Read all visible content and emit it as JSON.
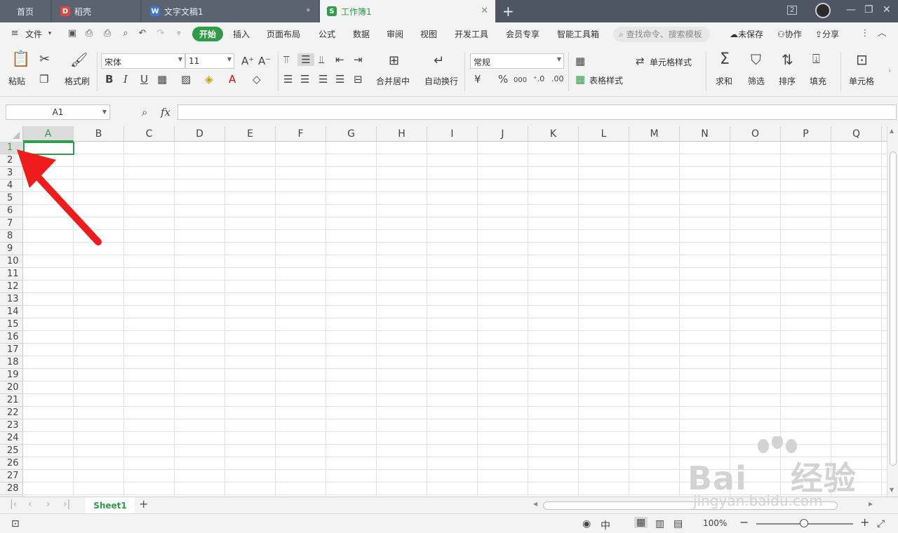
{
  "tabs": {
    "home": "首页",
    "docer": "稻壳",
    "word": "文字文稿1",
    "sheet": "工作簿1",
    "add": "+"
  },
  "window": {
    "badge": "2",
    "min": "—",
    "restore": "❐",
    "close": "✕"
  },
  "menubar": {
    "file": "文件",
    "items": [
      "开始",
      "插入",
      "页面布局",
      "公式",
      "数据",
      "审阅",
      "视图",
      "开发工具",
      "会员专享",
      "智能工具箱"
    ],
    "search_placeholder": "查找命令、搜索模板",
    "unsaved": "未保存",
    "collab": "协作",
    "share": "分享"
  },
  "ribbon": {
    "paste": "粘贴",
    "format_painter": "格式刷",
    "font_name": "宋体",
    "font_size": "11",
    "merge_center": "合并居中",
    "auto_wrap": "自动换行",
    "number_format": "常规",
    "cell_style": "单元格样式",
    "table_style": "表格样式",
    "sum": "求和",
    "filter": "筛选",
    "sort": "排序",
    "fill": "填充",
    "cell": "单元格",
    "bold": "B",
    "italic": "I",
    "underline": "U",
    "percent": "%",
    "thousands": "000",
    "currency": "¥"
  },
  "formula_bar": {
    "name_box": "A1",
    "fx": "fx",
    "value": ""
  },
  "grid": {
    "columns": [
      "A",
      "B",
      "C",
      "D",
      "E",
      "F",
      "G",
      "H",
      "I",
      "J",
      "K",
      "L",
      "M",
      "N",
      "O",
      "P",
      "Q"
    ],
    "rows": [
      "1",
      "2",
      "3",
      "4",
      "5",
      "6",
      "7",
      "8",
      "9",
      "10",
      "11",
      "12",
      "13",
      "14",
      "15",
      "16",
      "17",
      "18",
      "19",
      "20",
      "21",
      "22",
      "23",
      "24",
      "25",
      "26",
      "27",
      "28"
    ],
    "selected_cell": "A1"
  },
  "sheets": {
    "active": "Sheet1",
    "add": "+"
  },
  "statusbar": {
    "zoom": "100%"
  },
  "watermark": {
    "brand": "Bai",
    "brand_suffix": "经验",
    "url": "jingyan.baidu.com"
  },
  "colors": {
    "accent": "#2e9c48",
    "arrow": "#ee1c1c",
    "tabbar": "#4e5563"
  }
}
